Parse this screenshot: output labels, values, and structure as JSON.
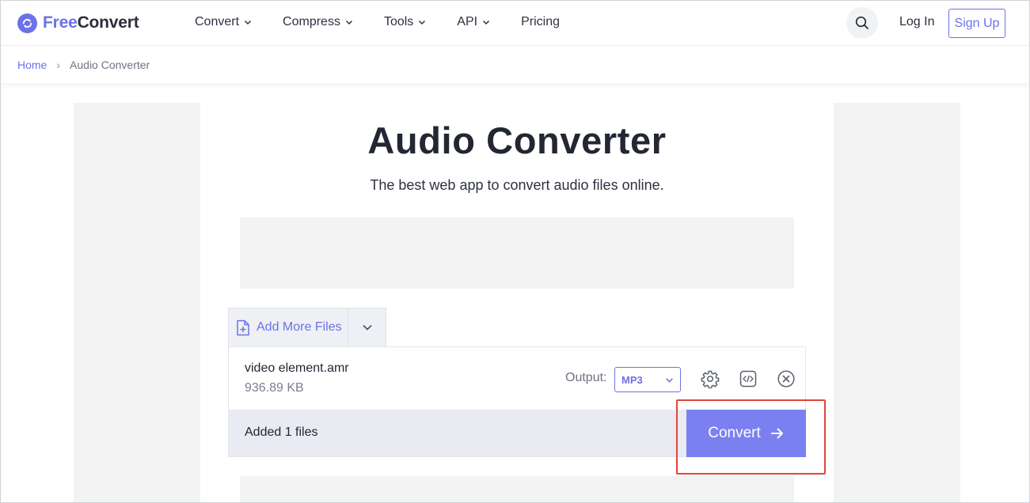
{
  "header": {
    "logo": {
      "part1": "Free",
      "part2": "Convert"
    },
    "nav": [
      {
        "label": "Convert",
        "has_dropdown": true
      },
      {
        "label": "Compress",
        "has_dropdown": true
      },
      {
        "label": "Tools",
        "has_dropdown": true
      },
      {
        "label": "API",
        "has_dropdown": true
      },
      {
        "label": "Pricing",
        "has_dropdown": false
      }
    ],
    "login_label": "Log In",
    "signup_label": "Sign Up"
  },
  "breadcrumb": {
    "home": "Home",
    "separator": "›",
    "current": "Audio Converter"
  },
  "main": {
    "title": "Audio Converter",
    "subtitle": "The best web app to convert audio files online."
  },
  "uploader": {
    "add_more_label": "Add More Files",
    "file": {
      "name": "video element.amr",
      "size": "936.89 KB"
    },
    "output_label": "Output:",
    "output_value": "MP3",
    "added_text": "Added 1 files",
    "convert_label": "Convert"
  },
  "colors": {
    "accent": "#6c72e8",
    "convert_button": "#7b80f0",
    "highlight": "#e2453b",
    "ad_placeholder": "#f3f3f3"
  },
  "icons": [
    "logo-sync-icon",
    "chevron-down-icon",
    "search-icon",
    "file-plus-icon",
    "settings-gear-icon",
    "code-icon",
    "close-circle-icon",
    "arrow-right-icon"
  ]
}
